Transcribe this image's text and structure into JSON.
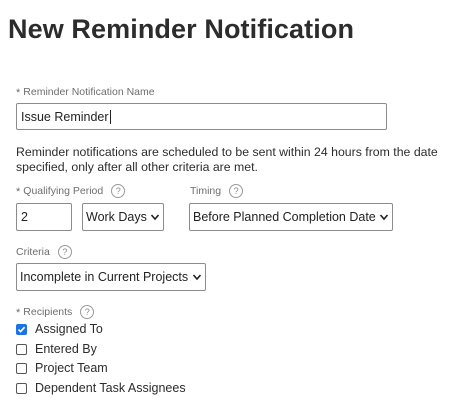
{
  "page": {
    "title": "New Reminder Notification"
  },
  "name_field": {
    "label": "Reminder Notification Name",
    "required_mark": "*",
    "value": "Issue Reminder"
  },
  "info_text": "Reminder notifications are scheduled to be sent within 24 hours from the date specified, only after all other criteria are met.",
  "qualifying_period": {
    "label": "Qualifying Period",
    "required_mark": "*",
    "help": "?",
    "value": "2",
    "unit_selected": "Work Days"
  },
  "timing": {
    "label": "Timing",
    "help": "?",
    "selected": "Before Planned Completion Date"
  },
  "criteria": {
    "label": "Criteria",
    "help": "?",
    "selected": "Incomplete in Current Projects"
  },
  "recipients": {
    "label": "Recipients",
    "required_mark": "*",
    "help": "?",
    "options": [
      {
        "label": "Assigned To",
        "checked": true
      },
      {
        "label": "Entered By",
        "checked": false
      },
      {
        "label": "Project Team",
        "checked": false
      },
      {
        "label": "Dependent Task Assignees",
        "checked": false
      }
    ]
  },
  "colors": {
    "accent": "#1a73e8",
    "text": "#2c2c2c",
    "label": "#6e6e6e",
    "border": "#8c8c8c"
  },
  "icons": {
    "help": "help-circle-icon",
    "dropdown": "chevron-down-icon",
    "check": "check-icon"
  }
}
